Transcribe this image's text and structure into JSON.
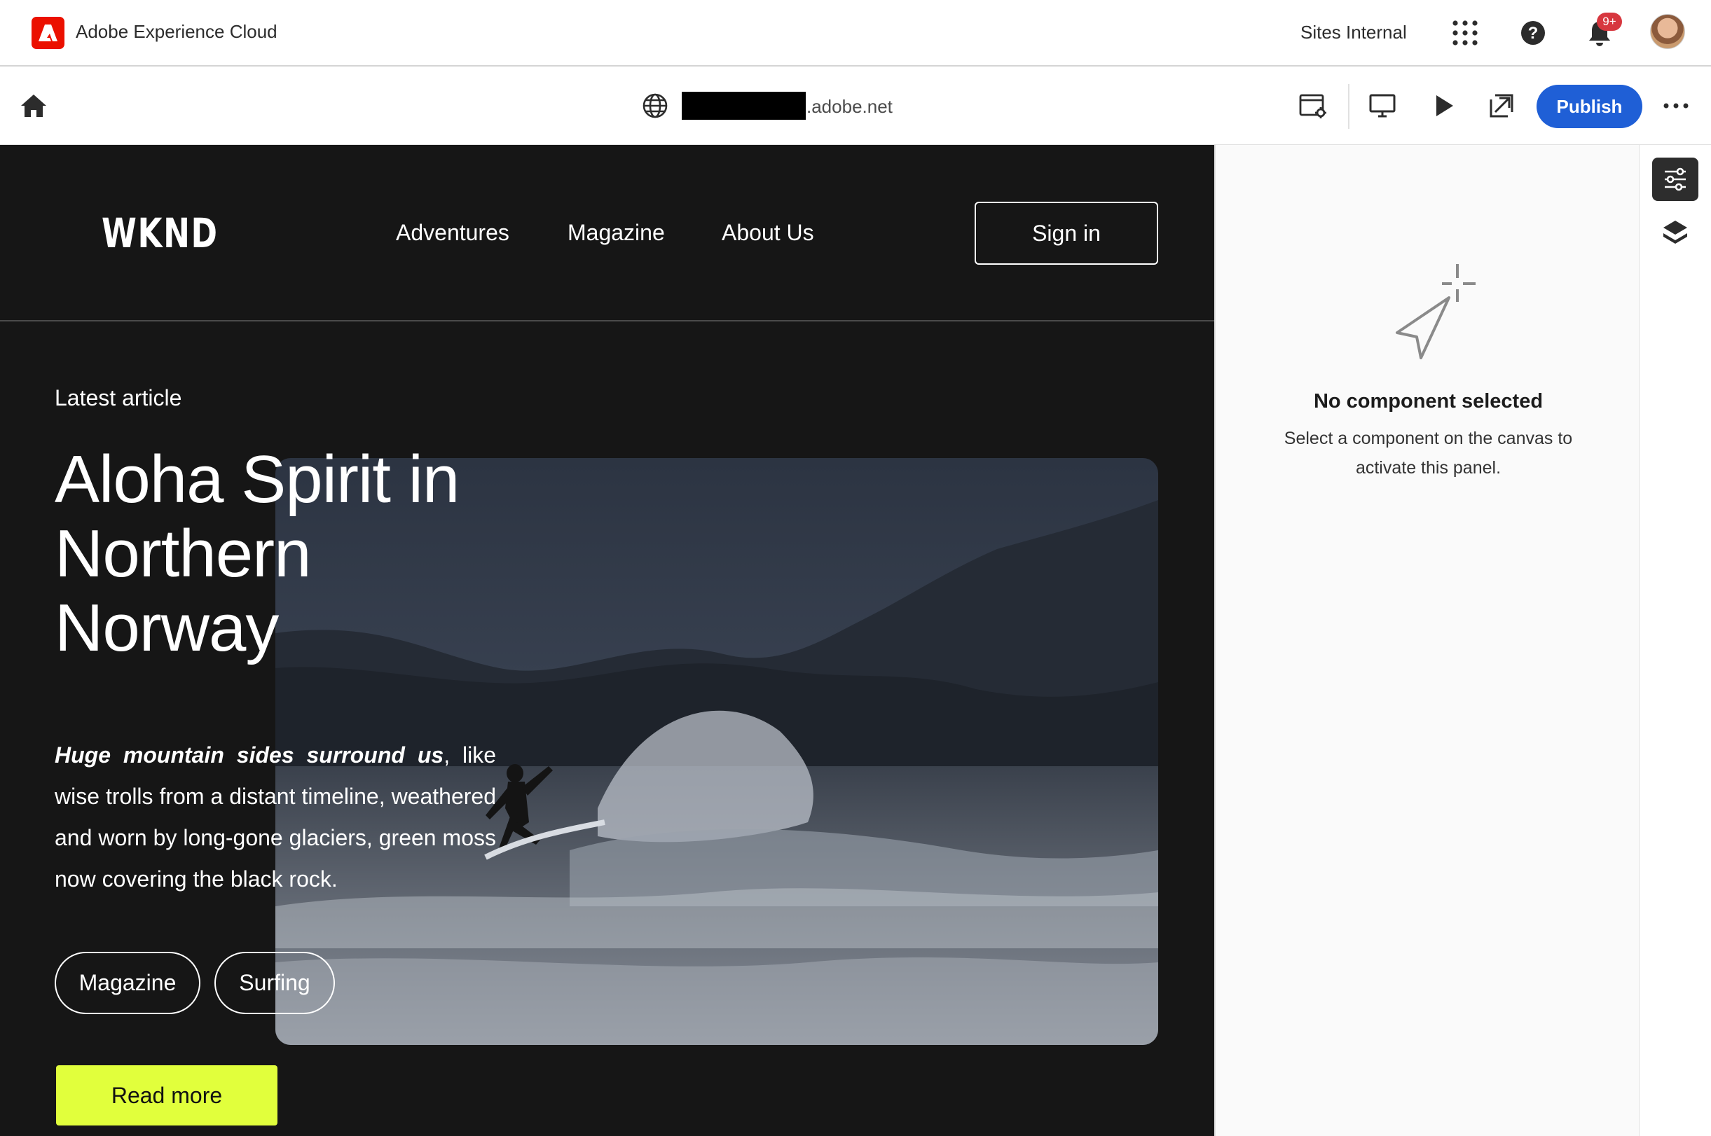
{
  "shell": {
    "app_title": "Adobe Experience Cloud",
    "org_name": "Sites Internal",
    "notifications_badge": "9+",
    "icons": [
      "adobe-logo",
      "apps-icon",
      "help-icon",
      "bell-icon",
      "avatar"
    ]
  },
  "toolbar": {
    "url_domain": ".adobe.net",
    "publish_label": "Publish",
    "icons": [
      "home-icon",
      "globe-icon",
      "page-properties-icon",
      "desktop-icon",
      "preview-icon",
      "open-in-new-icon",
      "more-icon"
    ]
  },
  "site": {
    "logo": "WKND",
    "nav": [
      "Adventures",
      "Magazine",
      "About Us"
    ],
    "signin_label": "Sign in",
    "eyebrow": "Latest article",
    "title": "Aloha Spirit in Northern Norway",
    "body_emphasis": "Huge mountain sides surround us",
    "body_rest": ", like wise trolls from a distant timeline, weathered and worn by long-gone glaciers, green moss now covering the black rock.",
    "tags": [
      "Magazine",
      "Surfing"
    ],
    "cta_label": "Read more",
    "colors": {
      "background": "#161616",
      "cta": "#e1ff3c"
    }
  },
  "panel": {
    "empty_title": "No component selected",
    "empty_desc": "Select a component on the canvas to activate this panel.",
    "rail_icons": [
      "properties-icon",
      "layers-icon"
    ]
  },
  "colors": {
    "brand_red": "#eb1000",
    "publish_blue": "#1f5fd6"
  }
}
